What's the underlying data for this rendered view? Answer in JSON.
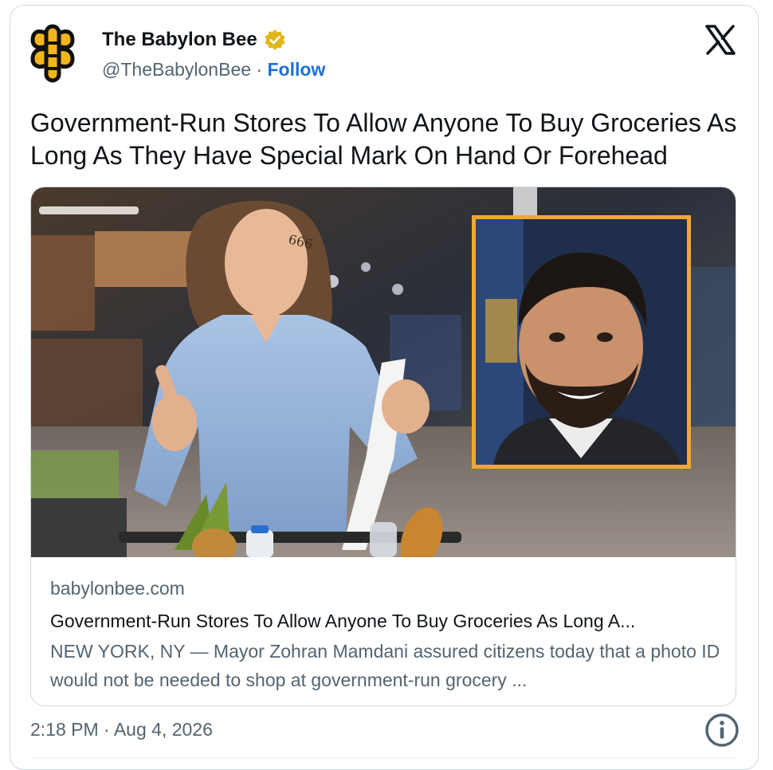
{
  "author": {
    "name": "The Babylon Bee",
    "handle": "@TheBabylonBee",
    "separator": "·",
    "follow_label": "Follow",
    "verified": true,
    "avatar_icon": "bee-logo-icon"
  },
  "post": {
    "text": "Government-Run Stores To Allow Anyone To Buy Groceries As Long As They Have Special Mark On Hand Or Forehead"
  },
  "link_card": {
    "forehead_mark": "666",
    "domain": "babylonbee.com",
    "title": "Government-Run Stores To Allow Anyone To Buy Groceries As Long A...",
    "description": "NEW YORK, NY — Mayor Zohran Mamdani assured citizens today that a photo ID would not be needed to shop at government-run grocery ..."
  },
  "footer": {
    "timestamp": "2:18 PM · Aug 4, 2026",
    "info_icon": "info-icon"
  },
  "colors": {
    "follow": "#1d6fd8",
    "verified_badge": "#e2b719",
    "inset_frame": "#f0a830",
    "secondary_text": "#536471"
  }
}
